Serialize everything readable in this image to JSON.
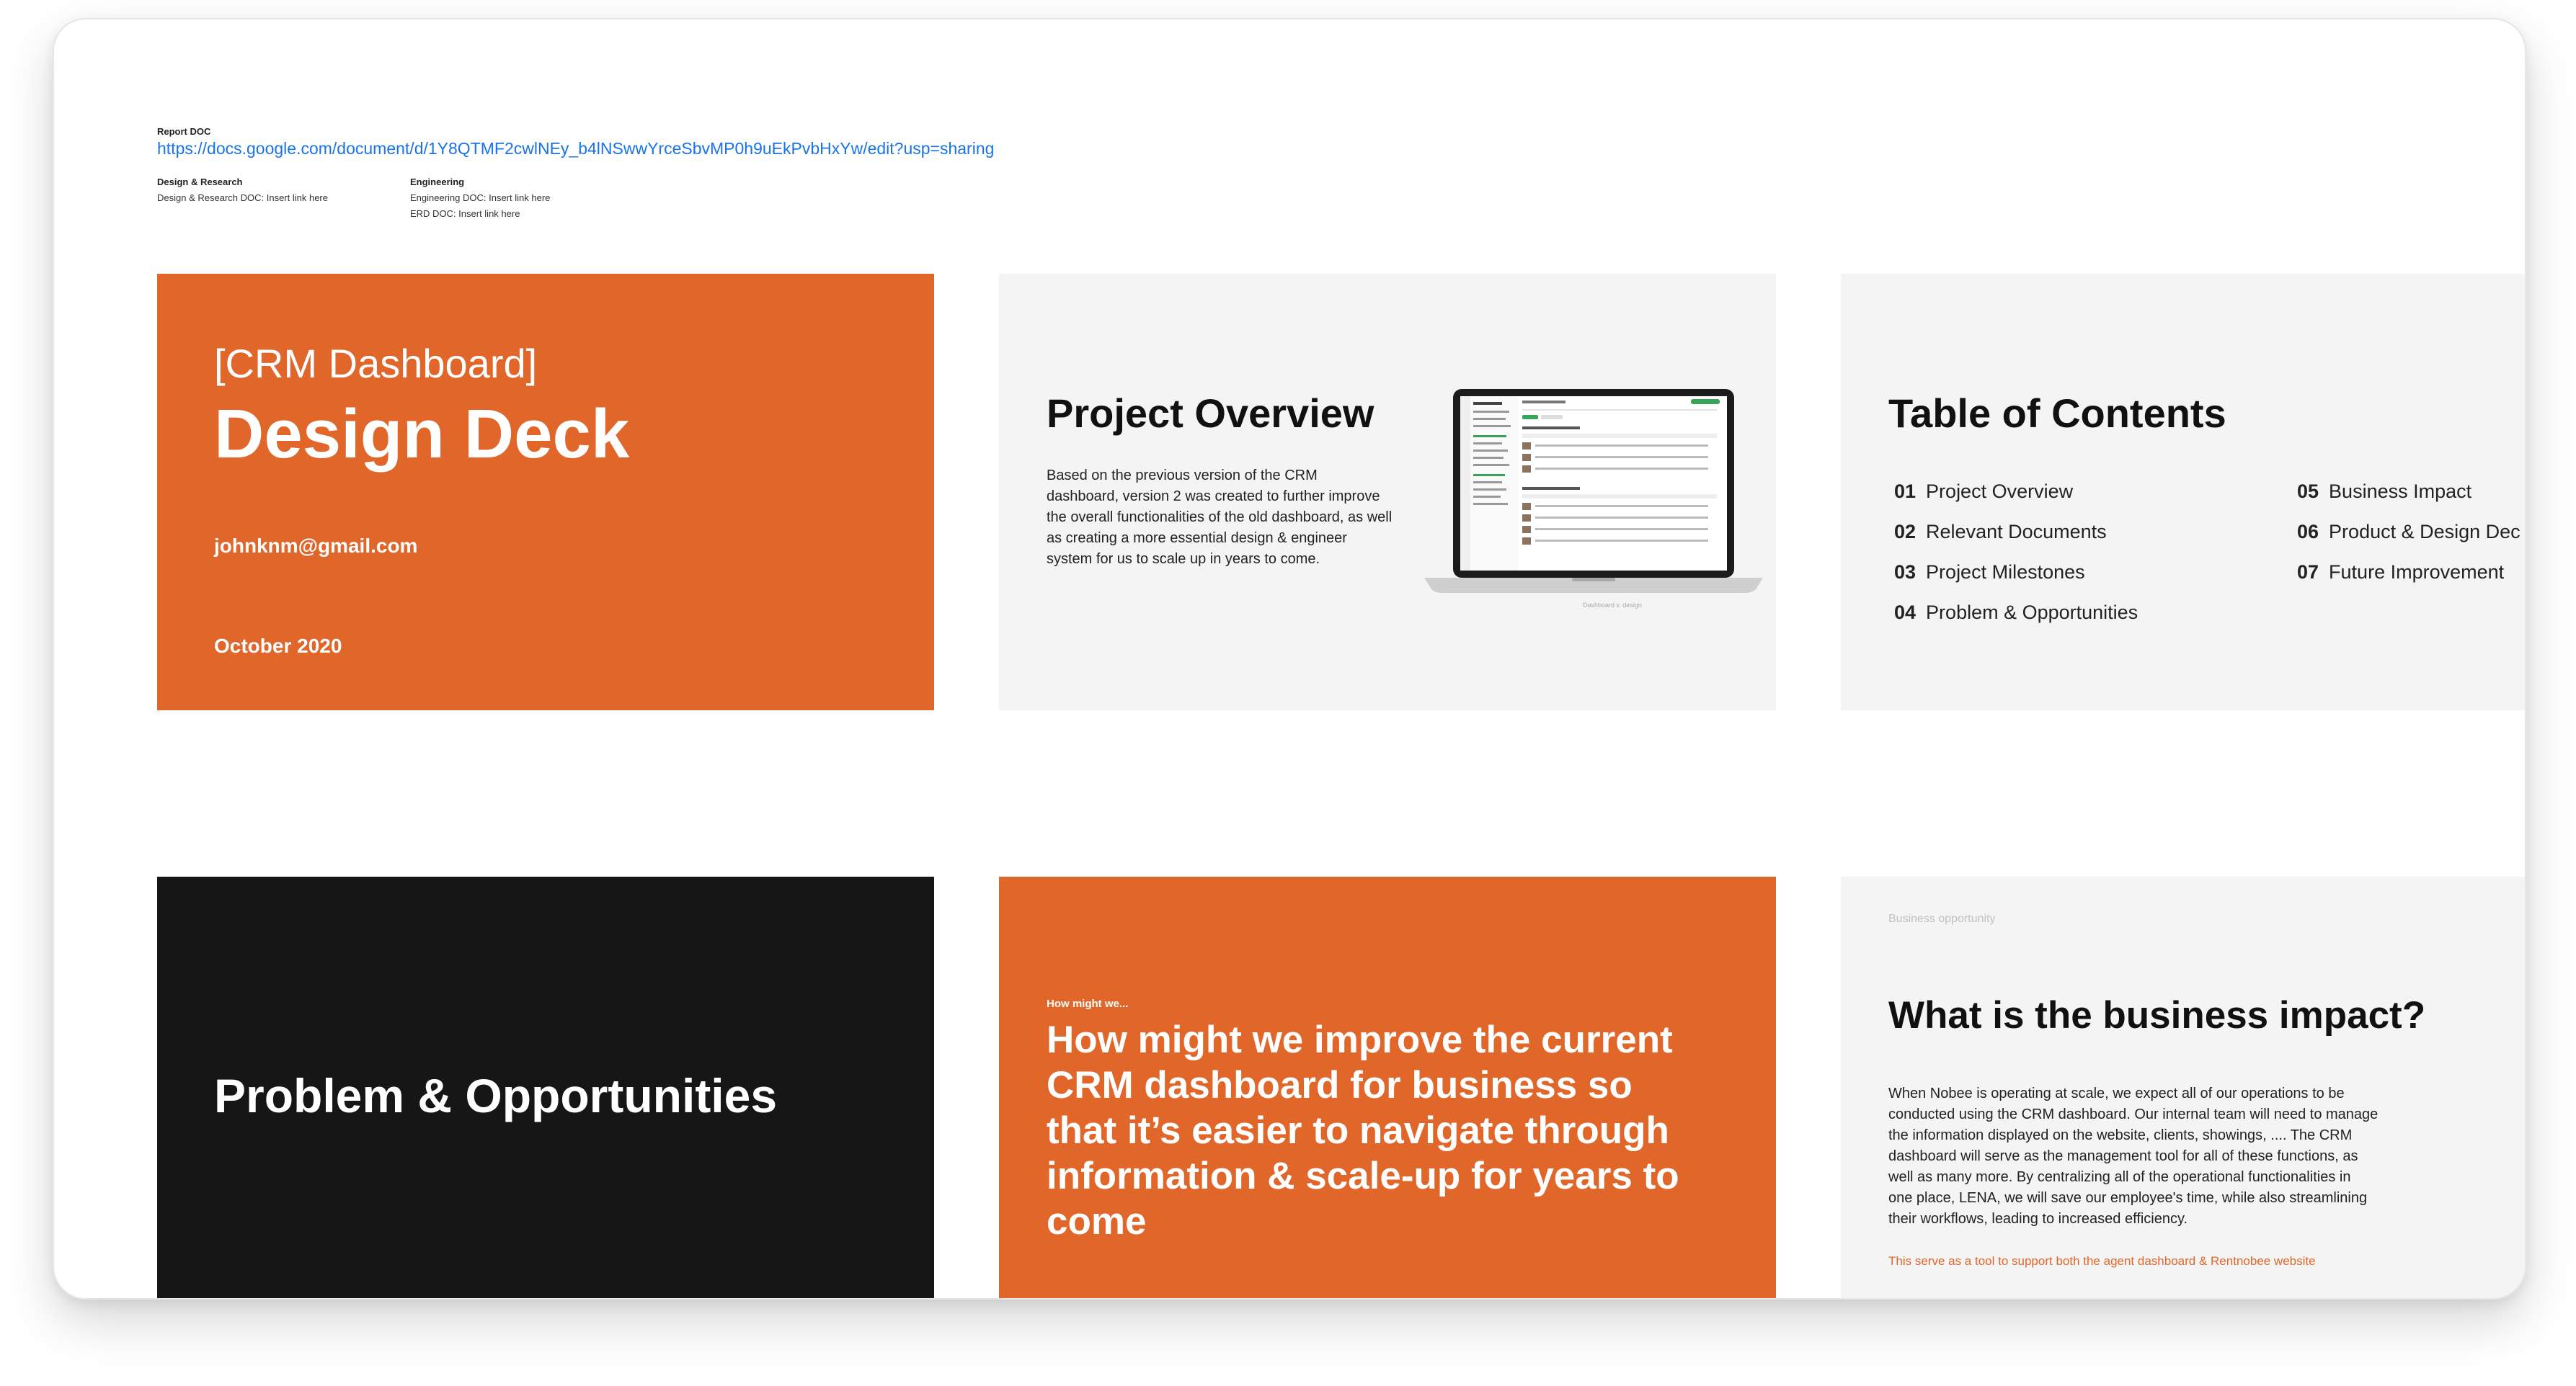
{
  "header": {
    "report_label": "Report DOC",
    "report_url": "https://docs.google.com/document/d/1Y8QTMF2cwlNEy_b4lNSwwYrceSbvMP0h9uEkPvbHxYw/edit?usp=sharing",
    "design_title": "Design & Research",
    "design_text": "Design & Research DOC: Insert link here",
    "engineering_title": "Engineering",
    "engineering_doc": "Engineering DOC: Insert link here",
    "erd_doc": "ERD DOC: Insert link here"
  },
  "slides": {
    "cover": {
      "bracket_title": "[CRM Dashboard]",
      "title": "Design Deck",
      "email": "johnknm@gmail.com",
      "date": "October 2020"
    },
    "overview": {
      "title": "Project Overview",
      "body": "Based on the previous version of the CRM dashboard, version 2 was created to further improve the overall functionalities of the old dashboard, as well as creating a more essential design & engineer system for us to scale up in years to come.",
      "caption": "Dashboard v. design"
    },
    "toc": {
      "title": "Table of Contents",
      "items": [
        {
          "num": "01",
          "label": "Project Overview"
        },
        {
          "num": "02",
          "label": "Relevant Documents"
        },
        {
          "num": "03",
          "label": "Project Milestones"
        },
        {
          "num": "04",
          "label": "Problem & Opportunities"
        },
        {
          "num": "05",
          "label": "Business Impact"
        },
        {
          "num": "06",
          "label": "Product & Design Dec"
        },
        {
          "num": "07",
          "label": "Future Improvement"
        }
      ]
    },
    "problem": {
      "title": "Problem & Opportunities"
    },
    "hmw": {
      "kicker": "How might we...",
      "question": "How might we improve the current CRM dashboard for business so that it’s easier to navigate through information &  scale-up for years to come"
    },
    "impact": {
      "kicker": "Business opportunity",
      "title": "What is the business impact?",
      "body": "When Nobee is operating at scale, we expect all of our operations to be conducted using the CRM dashboard. Our internal team will need to manage the information displayed on the website, clients, showings, .... The CRM dashboard will serve as the management tool for all of these functions, as well as many more. By centralizing all of the operational functionalities in one place, LENA, we will save our employee's time, while also streamlining their workflows, leading to increased efficiency.",
      "note": "This serve as a tool to support both the agent dashboard & Rentnobee website"
    }
  },
  "colors": {
    "accent": "#e0662a",
    "dark": "#161616",
    "panel": "#f4f4f4",
    "link": "#1a73e8",
    "success": "#3aa35b"
  }
}
